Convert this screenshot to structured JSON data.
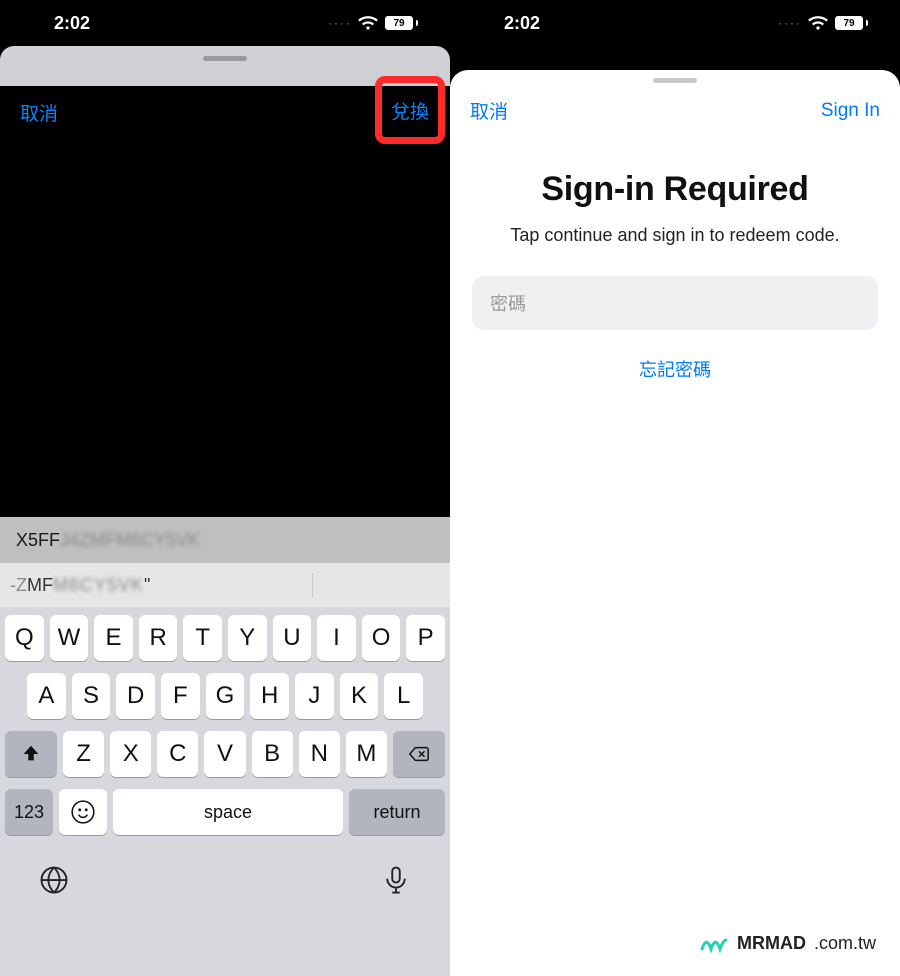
{
  "statusbar": {
    "time": "2:02",
    "battery": "79"
  },
  "left": {
    "cancel_label": "取消",
    "redeem_label": "兌換",
    "code_value_visible": "X5FF",
    "code_value_blurred": "J4ZMFM6CY5VK",
    "suggestion_prefix": "-Z",
    "suggestion_mid": "MF",
    "suggestion_blurred": "M6CY5VK",
    "suggestion_quote": "\""
  },
  "keyboard": {
    "row1": [
      "Q",
      "W",
      "E",
      "R",
      "T",
      "Y",
      "U",
      "I",
      "O",
      "P"
    ],
    "row2": [
      "A",
      "S",
      "D",
      "F",
      "G",
      "H",
      "J",
      "K",
      "L"
    ],
    "row3": [
      "Z",
      "X",
      "C",
      "V",
      "B",
      "N",
      "M"
    ],
    "num_label": "123",
    "space_label": "space",
    "return_label": "return"
  },
  "right": {
    "cancel_label": "取消",
    "signin_label": "Sign In",
    "title": "Sign-in Required",
    "subtitle": "Tap continue and sign in to redeem code.",
    "password_placeholder": "密碼",
    "forgot_label": "忘記密碼"
  },
  "watermark": {
    "brand": "MRMAD",
    "domain": ".com.tw"
  }
}
